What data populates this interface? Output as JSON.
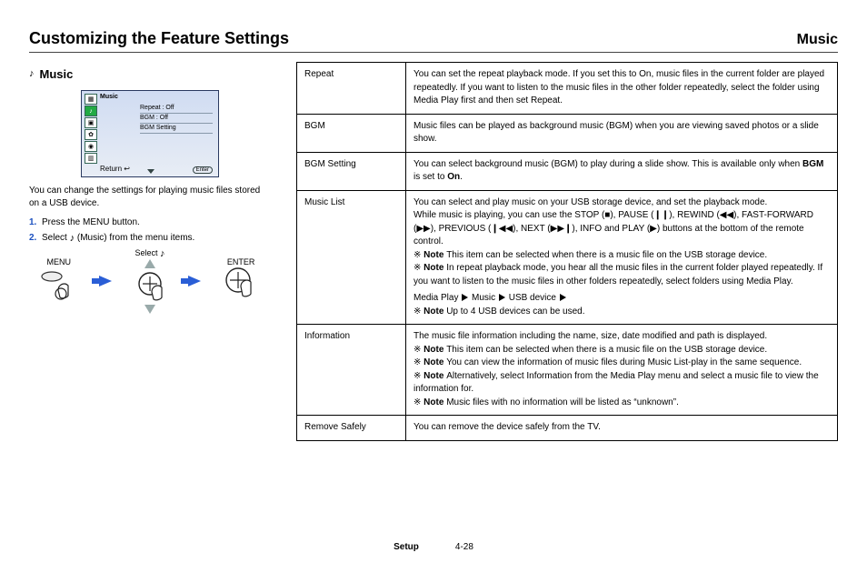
{
  "header": {
    "title": "Customizing the Feature Settings",
    "subtitle": "Music"
  },
  "left": {
    "music_heading": "Music",
    "caption": "You can change the settings for playing music files stored on a USB device.",
    "step1": "Press the MENU button.",
    "step2_a": "Select ",
    "step2_b": " (Music) from the menu items.",
    "screenshot": {
      "category": "Music",
      "items": [
        "Repeat : Off",
        "BGM : Off",
        "BGM Setting"
      ],
      "back": "Return",
      "ok": "Enter"
    },
    "labels": {
      "menu": "MENU",
      "select_icon": "Select",
      "enter": "ENTER"
    }
  },
  "table": {
    "rows": [
      {
        "label": "Repeat",
        "text": "You can set the repeat playback mode. If you set this to On, music files in the current folder are played repeatedly. If you want to listen to the music files in the other folder repeatedly, select the folder using Media Play first and then set Repeat."
      },
      {
        "label": "BGM",
        "text": "Music files can be played as background music (BGM) when you are viewing saved photos or a slide show."
      },
      {
        "label": "BGM Setting",
        "text_a": "You can select background music (BGM) to play during a slide show. This is available only when ",
        "text_b": "BGM",
        "text_c": " is set to ",
        "text_d": "On",
        "text_e": "."
      },
      {
        "label": "Music List",
        "text_a": "You can select and play music on your USB storage device, and set the playback mode.",
        "text_b": "While music is playing, you can use the STOP (■), PAUSE (❙❙), REWIND (◀◀), FAST-FORWARD (▶▶), PREVIOUS (❙◀◀), NEXT (▶▶❙), INFO and PLAY (▶) buttons at the bottom of the remote control.",
        "note_a_label": "Note",
        "note_a": "This item can be selected when there is a music file on the USB storage device.",
        "note_b_label": "Note",
        "note_b": "In repeat playback mode, you hear all the music files in the current folder played repeatedly. If you want to listen to the music files in other folders repeatedly, select folders using Media Play.",
        "path": [
          "Media Play",
          "Music",
          "USB device"
        ],
        "path_note_label": "Note",
        "path_note": "Up to 4 USB devices can be used."
      },
      {
        "label": "Information",
        "text": "The music file information including the name, size, date modified and path is displayed.",
        "note0_label": "Note",
        "note0": "This item can be selected when there is a music file on the USB storage device.",
        "note1_label": "Note",
        "note1": "You can view the information of music files during Music List-play in the same sequence.",
        "note2_label": "Note",
        "note2": "Alternatively, select Information from the Media Play menu and select a music file to view the information for.",
        "note3_label": "Note",
        "note3": "Music files with no information will be listed as “unknown”."
      },
      {
        "label": "Remove Safely",
        "text": "You can remove the device safely from the TV."
      }
    ]
  },
  "footer": {
    "section": "Setup",
    "page": "4-28"
  }
}
